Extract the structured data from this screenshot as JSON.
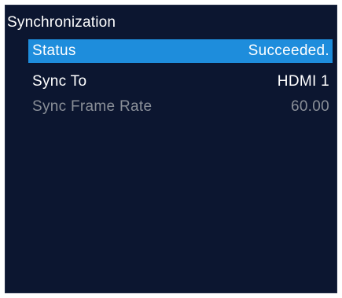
{
  "menu": {
    "title": "Synchronization",
    "items": [
      {
        "label": "Status",
        "value": "Succeeded."
      },
      {
        "label": "Sync To",
        "value": "HDMI 1"
      },
      {
        "label": "Sync Frame Rate",
        "value": "60.00"
      }
    ]
  },
  "colors": {
    "panel_background": "#0c1630",
    "selected_highlight": "#1e8ddc",
    "text_normal": "#ffffff",
    "text_disabled": "#8a8f98"
  }
}
